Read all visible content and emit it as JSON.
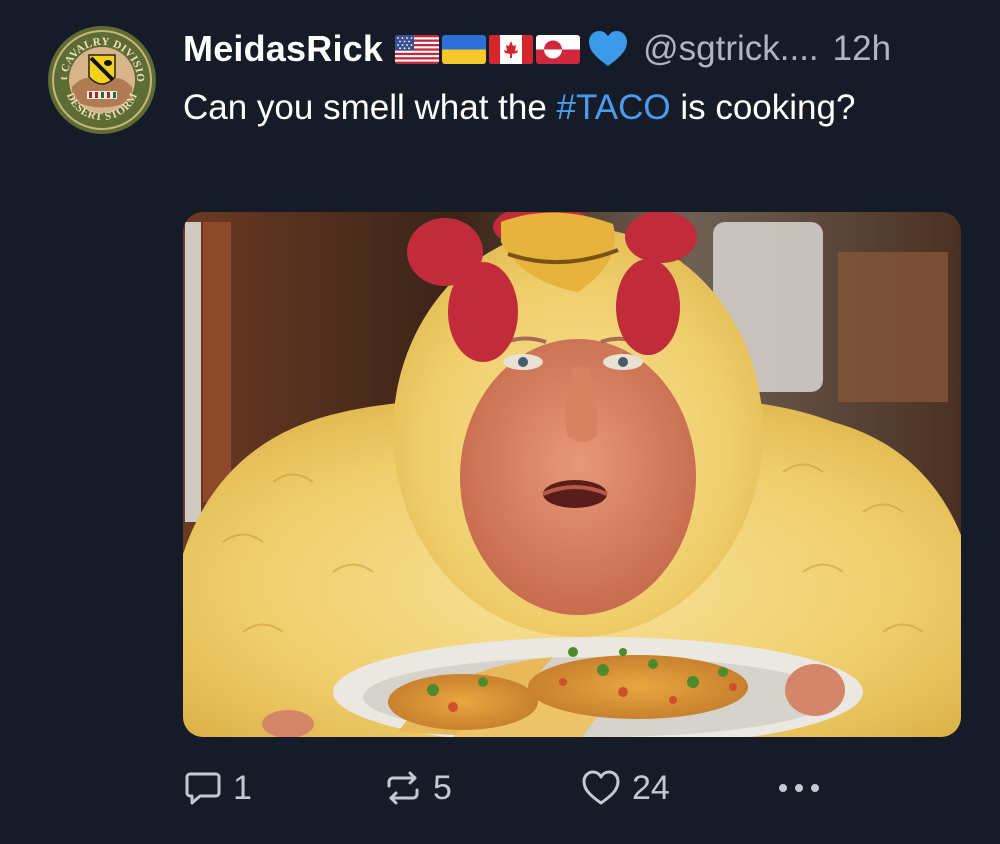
{
  "post": {
    "author": {
      "display_name": "MeidasRick",
      "handle": "@sgtrick....",
      "avatar": {
        "icon": "cavalry-division-patch-icon",
        "badge_top_text": "1st CAVALRY DIVISION",
        "badge_bottom_text": "DESERT STORM"
      },
      "name_emojis": [
        "us-flag-icon",
        "ukraine-flag-icon",
        "canada-flag-icon",
        "greenland-flag-icon",
        "blue-heart-icon"
      ]
    },
    "time_ago": "12h",
    "text_before": "Can you smell what the ",
    "hashtag": "#TACO",
    "text_after": " is cooking?",
    "media": {
      "type": "image",
      "subject": "man in chicken costume holding plate of tacos"
    },
    "actions": {
      "reply_count": "1",
      "repost_count": "5",
      "like_count": "24",
      "reply_icon": "reply-bubble-icon",
      "repost_icon": "repost-icon",
      "like_icon": "heart-outline-icon",
      "more_icon": "more-dots-icon"
    }
  },
  "colors": {
    "background": "#151c27",
    "hashtag": "#4a9cf0",
    "secondary_text": "#aeb6c3"
  }
}
